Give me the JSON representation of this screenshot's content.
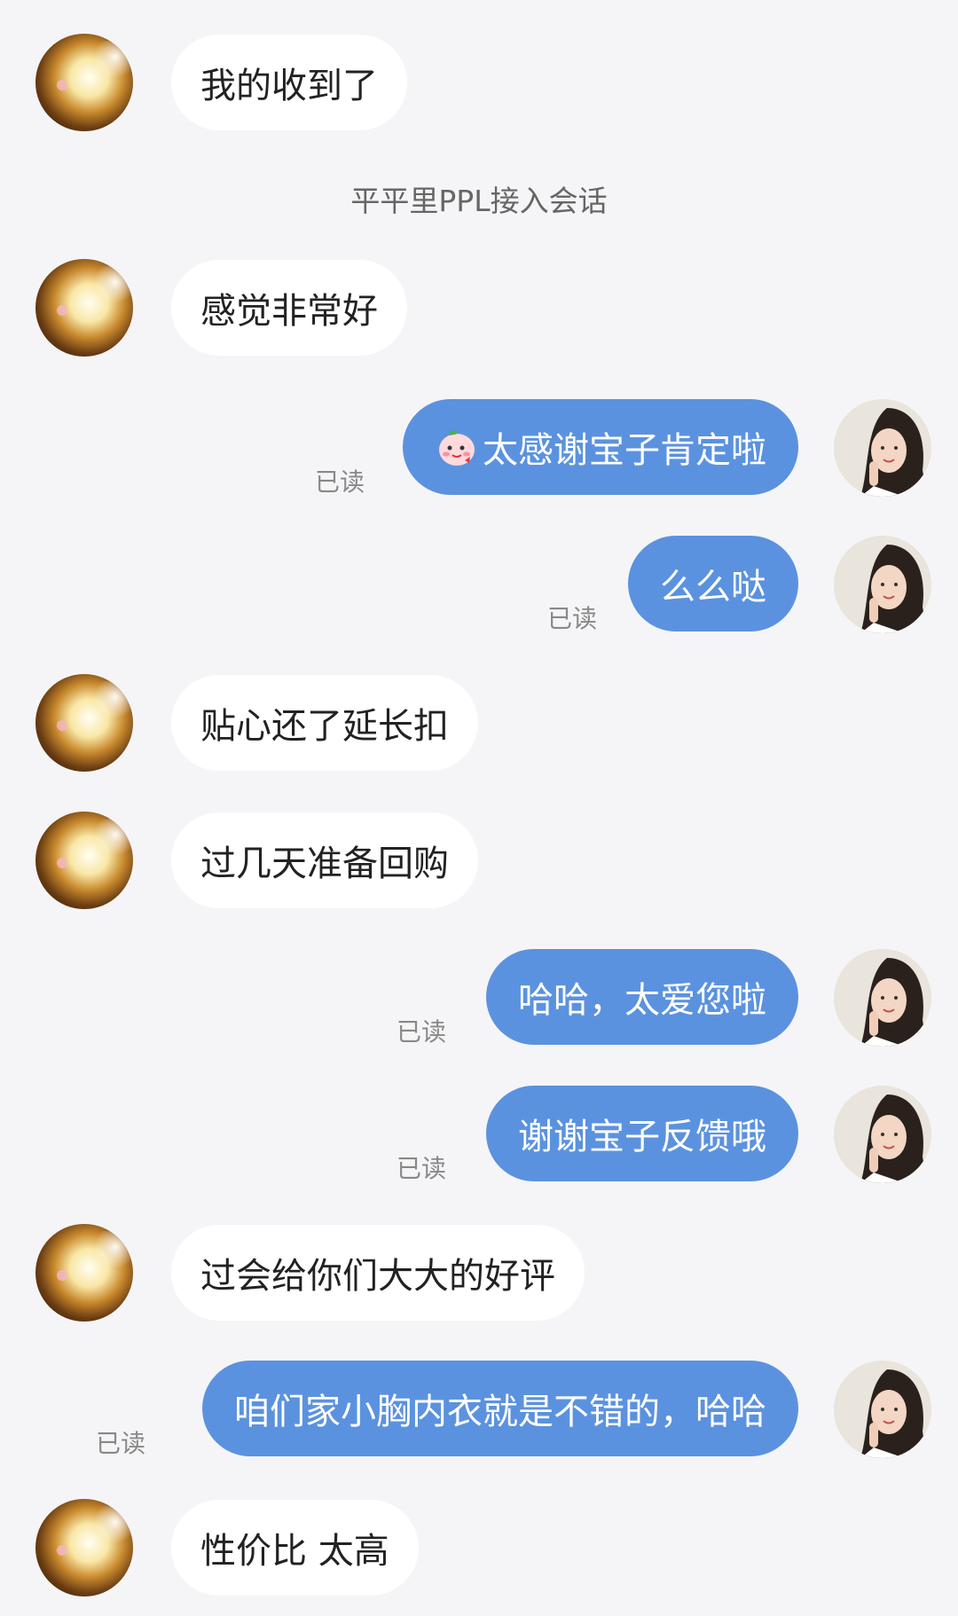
{
  "system_notice": "平平里PPL接入会话",
  "read_label": "已读",
  "messages": [
    {
      "from": "customer",
      "text": "我的收到了"
    },
    {
      "from": "customer",
      "text": "感觉非常好"
    },
    {
      "from": "agent",
      "text": "太感谢宝子肯定啦",
      "emoji": "blushing-peach-emoji",
      "status": "已读"
    },
    {
      "from": "agent",
      "text": "么么哒",
      "status": "已读"
    },
    {
      "from": "customer",
      "text": "贴心还了延长扣"
    },
    {
      "from": "customer",
      "text": "过几天准备回购"
    },
    {
      "from": "agent",
      "text": "哈哈，太爱您啦",
      "status": "已读"
    },
    {
      "from": "agent",
      "text": "谢谢宝子反馈哦",
      "status": "已读"
    },
    {
      "from": "customer",
      "text": "过会给你们大大的好评"
    },
    {
      "from": "agent",
      "text": "咱们家小胸内衣就是不错的，哈哈",
      "status": "已读"
    },
    {
      "from": "customer",
      "text": "性价比 太高"
    }
  ],
  "colors": {
    "agent_bubble": "#5b92df",
    "customer_bubble": "#ffffff",
    "background": "#f5f5f7"
  }
}
